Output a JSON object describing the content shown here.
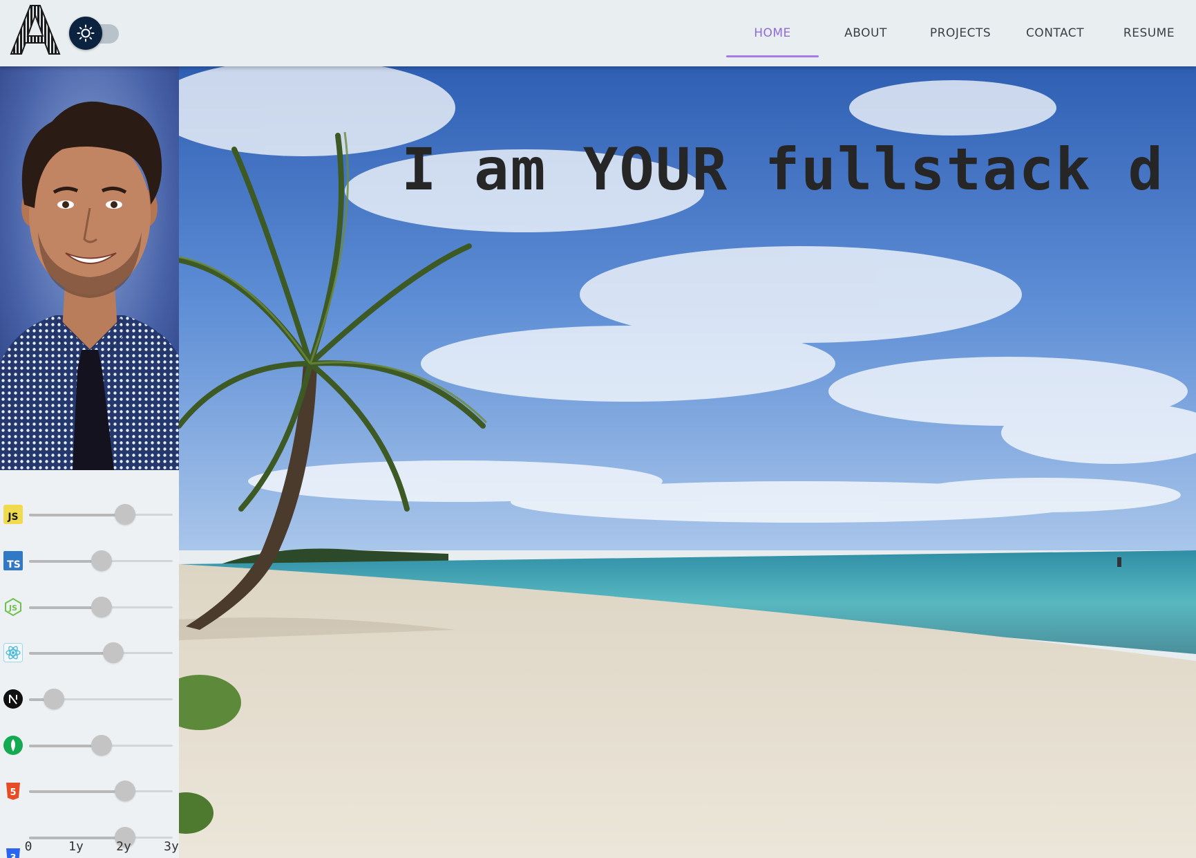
{
  "header": {
    "logo_letter": "A",
    "theme_toggle": {
      "icon": "sun-icon",
      "state": "light"
    },
    "nav": [
      {
        "label": "HOME",
        "active": true
      },
      {
        "label": "ABOUT",
        "active": false
      },
      {
        "label": "PROJECTS",
        "active": false
      },
      {
        "label": "CONTACT",
        "active": false
      },
      {
        "label": "RESUME",
        "active": false
      }
    ],
    "accent_color": "#a57be6"
  },
  "sidebar": {
    "skills": [
      {
        "icon": "javascript-icon",
        "years": 2
      },
      {
        "icon": "typescript-icon",
        "years": 1.5
      },
      {
        "icon": "nodejs-icon",
        "years": 1.5
      },
      {
        "icon": "react-icon",
        "years": 1.75
      },
      {
        "icon": "nextjs-icon",
        "years": 0.5
      },
      {
        "icon": "mongodb-icon",
        "years": 1.5
      },
      {
        "icon": "html5-icon",
        "years": 2
      },
      {
        "icon": "css3-icon",
        "years": 2
      }
    ],
    "scale_max_years": 3,
    "marks": [
      "0",
      "1y",
      "2y",
      "3y"
    ]
  },
  "hero": {
    "headline": "I am YOUR fullstack d"
  }
}
